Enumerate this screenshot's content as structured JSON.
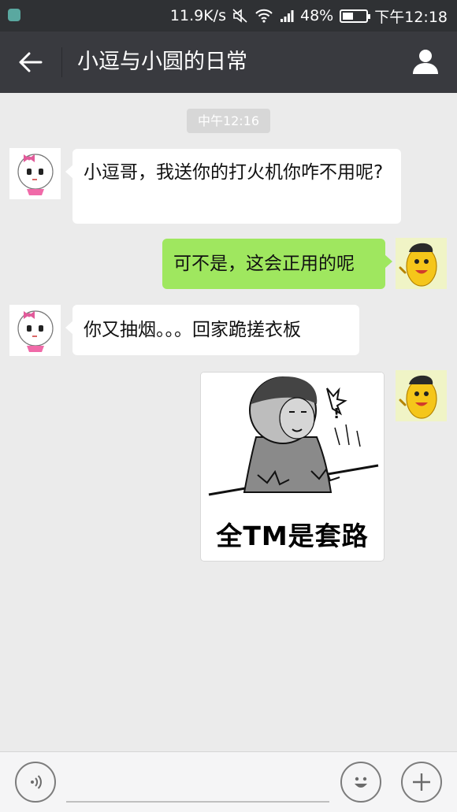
{
  "status_bar": {
    "speed": "11.9K/s",
    "battery_percent": "48%",
    "battery_level": 0.48,
    "time": "下午12:18"
  },
  "header": {
    "title": "小逗与小圆的日常",
    "back_icon": "arrow-left-icon",
    "profile_icon": "person-icon"
  },
  "messages": {
    "timestamp": "中午12:16",
    "items": [
      {
        "side": "left",
        "text": "小逗哥，我送你的打火机你咋不用呢?"
      },
      {
        "side": "right",
        "text": "可不是，这会正用的呢"
      },
      {
        "side": "left",
        "text": "你又抽烟。。。回家跪搓衣板"
      },
      {
        "side": "right",
        "type": "image",
        "caption": "全TM是套路"
      }
    ]
  },
  "input_bar": {
    "voice_icon": "voice-icon",
    "emoji_icon": "emoji-icon",
    "plus_icon": "plus-icon"
  },
  "colors": {
    "title_bar": "#393a3f",
    "status_bar": "#2f3134",
    "chat_background": "#ebebeb",
    "my_bubble": "#9fe75f",
    "their_bubble": "#ffffff"
  }
}
